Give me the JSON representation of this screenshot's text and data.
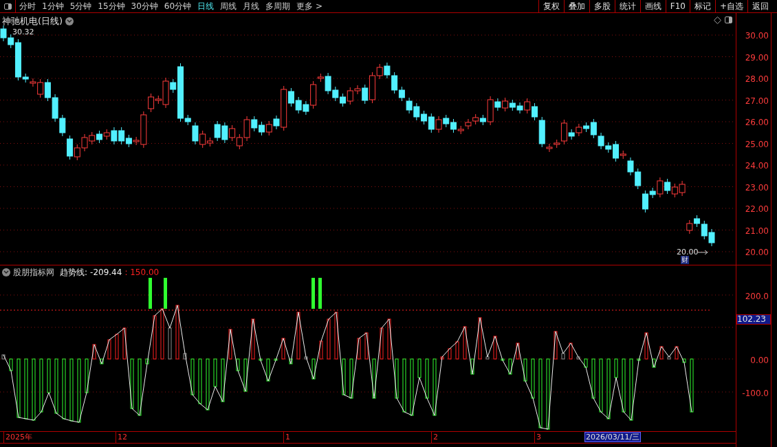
{
  "toolbar": {
    "periods": [
      {
        "label": "分时",
        "selected": false
      },
      {
        "label": "1分钟",
        "selected": false
      },
      {
        "label": "5分钟",
        "selected": false
      },
      {
        "label": "15分钟",
        "selected": false
      },
      {
        "label": "30分钟",
        "selected": false
      },
      {
        "label": "60分钟",
        "selected": false
      },
      {
        "label": "日线",
        "selected": true
      },
      {
        "label": "周线",
        "selected": false
      },
      {
        "label": "月线",
        "selected": false
      },
      {
        "label": "多周期",
        "selected": false
      },
      {
        "label": "更多 >",
        "selected": false
      }
    ],
    "buttons": [
      "复权",
      "叠加",
      "多股",
      "统计",
      "画线",
      "F10",
      "标记",
      "+自选",
      "返回"
    ]
  },
  "price_chart": {
    "title": "神驰机电(日线)",
    "high_label": "30.32",
    "low_label": "20.00",
    "low_badge": "财",
    "axis": [
      "30.00",
      "29.00",
      "28.00",
      "27.00",
      "26.00",
      "25.00",
      "24.00",
      "23.00",
      "22.00",
      "21.00",
      "20.00"
    ]
  },
  "indicator": {
    "name": "股朋指标网",
    "line_label": "趋势线:",
    "line_value": "-209.44",
    "threshold": ": 150.00",
    "axis": [
      "200.0",
      "0.00",
      "-100.0"
    ],
    "current_value": "102.23"
  },
  "date_axis": {
    "labels": [
      "2025年",
      "12",
      "1",
      "2",
      "3"
    ],
    "cursor_date": "2026/03/11/三"
  }
}
